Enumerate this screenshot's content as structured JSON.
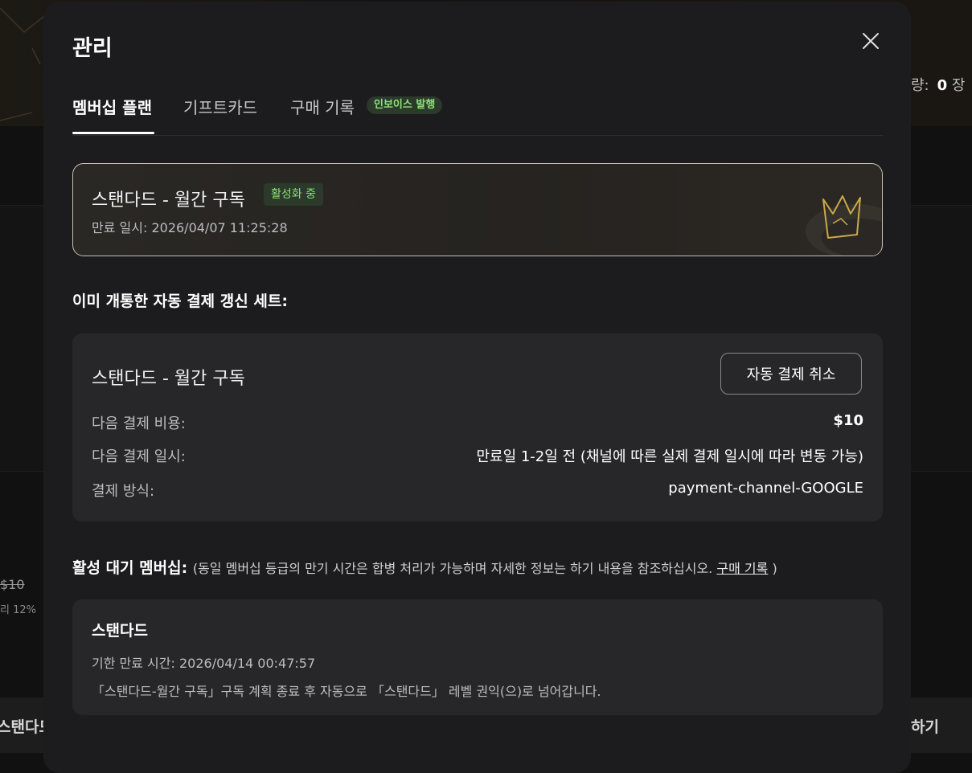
{
  "background": {
    "right_header_label": "량:",
    "right_header_count": "0",
    "right_header_unit": "장",
    "left_price": "$10",
    "left_discount": "리 12%",
    "bottom_left_text": "스탠다드",
    "bottom_right_text": "하기"
  },
  "modal": {
    "title": "관리",
    "tabs": [
      {
        "label": "멤버십 플랜",
        "active": true
      },
      {
        "label": "기프트카드",
        "active": false
      },
      {
        "label": "구매 기록",
        "active": false
      }
    ],
    "invoice_badge": "인보이스 발행"
  },
  "current_plan": {
    "name": "스탠다드 - 월간 구독",
    "status_badge": "활성화 중",
    "expiry_label": "만료 일시:",
    "expiry_value": "2026/04/07 11:25:28"
  },
  "auto_renew": {
    "section_title": "이미 개통한 자동 결제 갱신 세트:",
    "plan_name": "스탠다드 - 월간 구독",
    "cancel_button": "자동 결제 취소",
    "rows": [
      {
        "label": "다음 결제 비용:",
        "value": "$10"
      },
      {
        "label": "다음 결제 일시:",
        "value": "만료일 1-2일 전 (채널에 따른 실제 결제 일시에 따라 변동 가능)"
      },
      {
        "label": "결제 방식:",
        "value": "payment-channel-GOOGLE"
      }
    ]
  },
  "pending": {
    "section_title": "활성 대기 멤버십:",
    "section_note": "(동일 멤버십 등급의 만기 시간은 합병 처리가 가능하며 자세한 정보는 하기 내용을 참조하십시오.",
    "section_link": "구매 기록",
    "section_note_end": ")",
    "name": "스탠다드",
    "expiry_label": "기한 만료 시간:",
    "expiry_value": "2026/04/14 00:47:57",
    "description": "「스탠다드-월간 구독」구독 계획 종료 후 자동으로 「스탠다드」 레벨 권익(으)로 넘어갑니다."
  },
  "colors": {
    "modal_bg": "#1c1c1e",
    "card_bg": "#27272a",
    "badge_green_text": "#8fe07a",
    "badge_green_bg": "#2b3a2a"
  }
}
